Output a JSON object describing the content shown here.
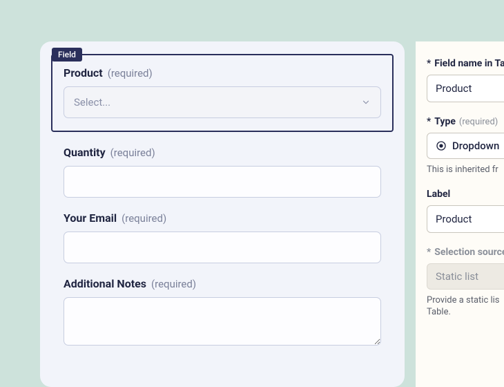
{
  "form": {
    "selectedTag": "Field",
    "fields": [
      {
        "label": "Product",
        "required": "(required)",
        "type": "select",
        "placeholder": "Select..."
      },
      {
        "label": "Quantity",
        "required": "(required)",
        "type": "text",
        "value": ""
      },
      {
        "label": "Your Email",
        "required": "(required)",
        "type": "text",
        "value": ""
      },
      {
        "label": "Additional Notes",
        "required": "(required)",
        "type": "textarea",
        "value": ""
      }
    ]
  },
  "panel": {
    "fieldName": {
      "label": "Field name in Ta",
      "value": "Product",
      "asterisk": "*"
    },
    "type": {
      "label": "Type",
      "required": "(required)",
      "value": "Dropdown",
      "asterisk": "*",
      "help": "This is inherited fr"
    },
    "displayLabel": {
      "label": "Label",
      "value": "Product"
    },
    "selectionSource": {
      "label": "Selection source",
      "asterisk": "*",
      "value": "Static list",
      "help1": "Provide a static lis",
      "help2": "Table."
    }
  }
}
